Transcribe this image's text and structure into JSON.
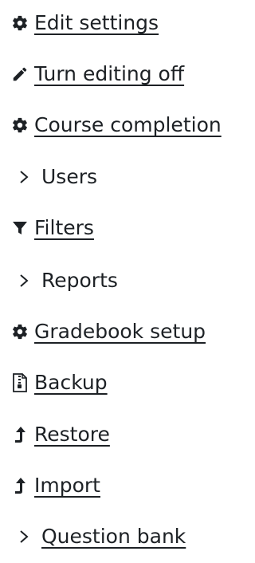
{
  "menu": {
    "items": [
      {
        "label": "Edit settings",
        "icon": "gear-icon",
        "link": true
      },
      {
        "label": "Turn editing off",
        "icon": "pencil-icon",
        "link": true
      },
      {
        "label": "Course completion",
        "icon": "gear-icon",
        "link": true
      },
      {
        "label": "Users",
        "icon": "chevron-right-icon",
        "link": false
      },
      {
        "label": "Filters",
        "icon": "filter-icon",
        "link": true
      },
      {
        "label": "Reports",
        "icon": "chevron-right-icon",
        "link": false
      },
      {
        "label": "Gradebook setup",
        "icon": "gear-icon",
        "link": true
      },
      {
        "label": "Backup",
        "icon": "file-archive-icon",
        "link": true
      },
      {
        "label": "Restore",
        "icon": "level-up-icon",
        "link": true
      },
      {
        "label": "Import",
        "icon": "level-up-icon",
        "link": true
      },
      {
        "label": "Question bank",
        "icon": "chevron-right-icon",
        "link": true
      }
    ]
  },
  "colors": {
    "text": "#1d2125",
    "background": "#ffffff"
  }
}
